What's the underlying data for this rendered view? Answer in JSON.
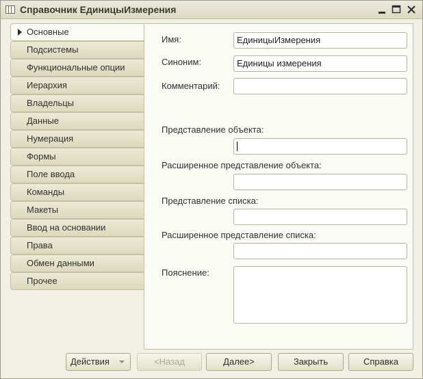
{
  "window": {
    "title": "Справочник ЕдиницыИзмерения"
  },
  "tabs": [
    {
      "label": "Основные",
      "active": true
    },
    {
      "label": "Подсистемы"
    },
    {
      "label": "Функциональные опции"
    },
    {
      "label": "Иерархия"
    },
    {
      "label": "Владельцы"
    },
    {
      "label": "Данные"
    },
    {
      "label": "Нумерация"
    },
    {
      "label": "Формы"
    },
    {
      "label": "Поле ввода"
    },
    {
      "label": "Команды"
    },
    {
      "label": "Макеты"
    },
    {
      "label": "Ввод на основании"
    },
    {
      "label": "Права"
    },
    {
      "label": "Обмен данными"
    },
    {
      "label": "Прочее"
    }
  ],
  "form": {
    "name_label": "Имя:",
    "name_value": "ЕдиницыИзмерения",
    "synonym_label": "Синоним:",
    "synonym_value": "Единицы измерения",
    "comment_label": "Комментарий:",
    "comment_value": "",
    "object_presentation_label": "Представление объекта:",
    "object_presentation_value": "",
    "ext_object_presentation_label": "Расширенное представление объекта:",
    "ext_object_presentation_value": "",
    "list_presentation_label": "Представление списка:",
    "list_presentation_value": "",
    "ext_list_presentation_label": "Расширенное представление списка:",
    "ext_list_presentation_value": "",
    "explanation_label": "Пояснение:",
    "explanation_value": ""
  },
  "buttons": {
    "actions": "Действия",
    "back": "<Назад",
    "next": "Далее>",
    "close": "Закрыть",
    "help": "Справка"
  }
}
